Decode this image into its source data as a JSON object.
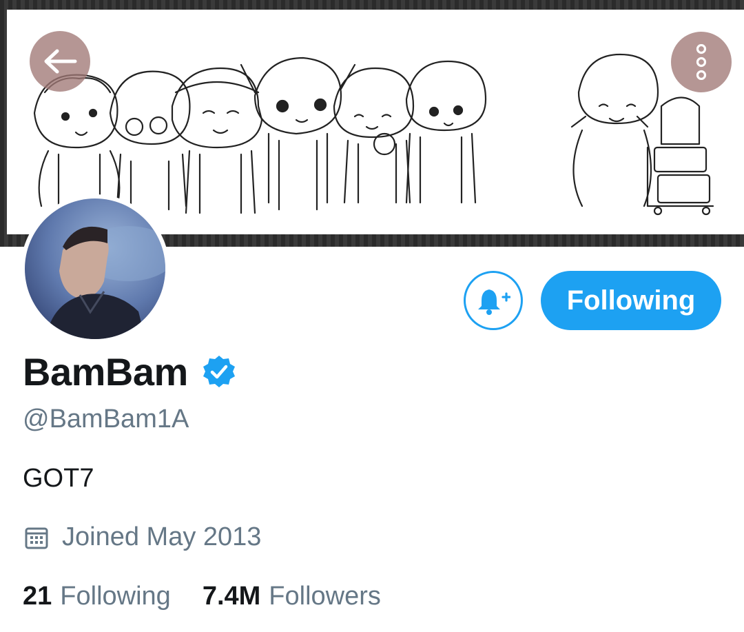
{
  "header": {
    "back_icon": "arrow-left-icon",
    "more_icon": "vertical-dots-icon",
    "overlay_color": "#a07876"
  },
  "profile": {
    "display_name": "BamBam",
    "verified_icon": "verified-badge-icon",
    "handle": "@BamBam1A",
    "bio": "GOT7",
    "joined": "Joined May 2013",
    "joined_icon": "calendar-icon"
  },
  "actions": {
    "notify_icon": "bell-plus-icon",
    "follow_button_label": "Following"
  },
  "stats": {
    "following_count": "21",
    "following_label": "Following",
    "followers_count": "7.4M",
    "followers_label": "Followers"
  },
  "colors": {
    "accent": "#1da1f2",
    "secondary_text": "#657786",
    "primary_text": "#14171a"
  }
}
